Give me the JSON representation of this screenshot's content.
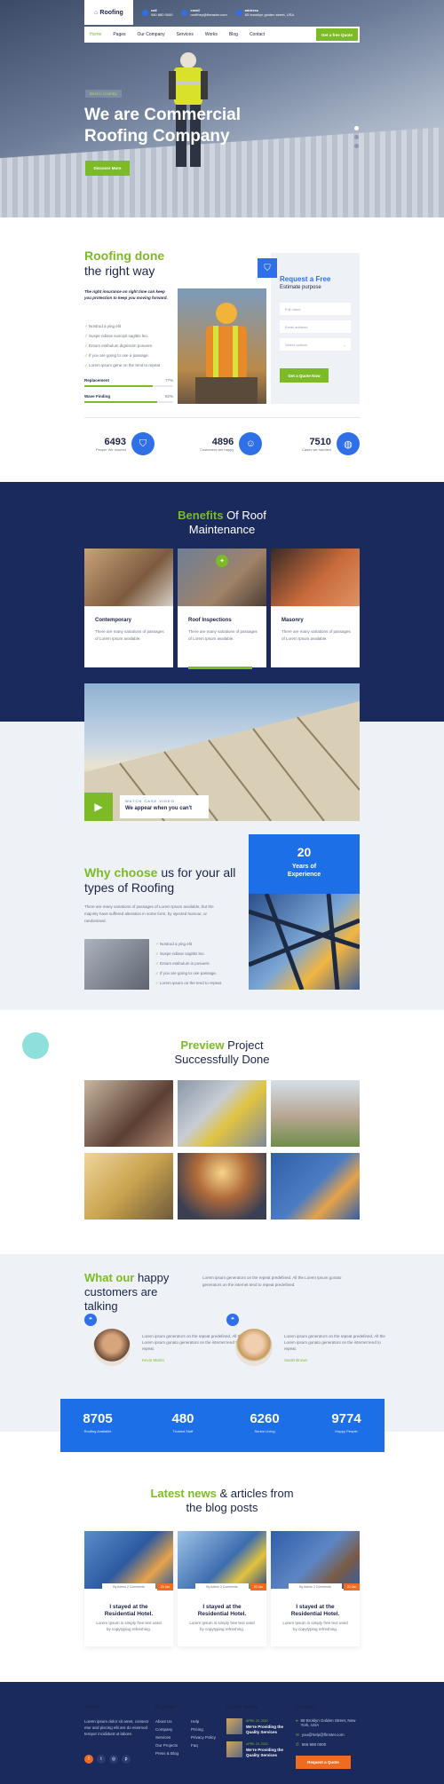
{
  "brand": {
    "logo": "Roofing",
    "accent_green": "#7cbb26",
    "accent_blue": "#2f6fe8",
    "navy": "#1b2a5c"
  },
  "topbar": {
    "call_label": "call",
    "call_value": "080 880 0000",
    "email_label": "email",
    "email_value": "roofthey@flmaster.com",
    "address_label": "address",
    "address_value": "83 brooklyn golden street, USA"
  },
  "nav": {
    "items": [
      "Home",
      "Pages",
      "Our Company",
      "Services",
      "Works",
      "Blog",
      "Contact"
    ],
    "quote_btn": "Get a free Quote"
  },
  "hero": {
    "tag": "Best in Country",
    "title_line1": "We are Commercial",
    "title_line2": "Roofing Company",
    "button": "Discover More"
  },
  "about": {
    "title_green": "Roofing done",
    "title_rest": "the right way",
    "intro": "The right insurance on right time can keep you protection to keep you moving forward.",
    "checks": [
      "Nostrud a ying elit",
      "Suspe ndisse suscipit sagittis leo.",
      "Entum estibulum dignissim posuere.",
      "If you are going to use a passage.",
      "Lorem ipsum gene on the tend to repeat"
    ],
    "skills": [
      {
        "name": "Replacement",
        "pct": "77%",
        "value": 0.77
      },
      {
        "name": "Wave Finding",
        "pct": "82%",
        "value": 0.82
      }
    ]
  },
  "form": {
    "title": "Request a Free",
    "subtitle": "Estimate purpose",
    "name_ph": "Full name",
    "email_ph": "Email address",
    "service_ph": "Select options",
    "button": "Get a Quote Now"
  },
  "stats": [
    {
      "num": "6493",
      "label": "People We Insured",
      "icon": "shield-icon"
    },
    {
      "num": "4896",
      "label": "Customers are happy",
      "icon": "people-icon"
    },
    {
      "num": "7510",
      "label": "Cases we handled",
      "icon": "globe-icon"
    }
  ],
  "benefits": {
    "title_green": "Benefits",
    "title_rest": "Of Roof",
    "title_line2": "Maintenance",
    "cards": [
      {
        "title": "Contemporary",
        "text": "There are many variations of passages of Lorem Ipsum available."
      },
      {
        "title": "Roof Inspections",
        "text": "There are many variations of passages of Lorem Ipsum available."
      },
      {
        "title": "Masonry",
        "text": "There are many variations of passages of Lorem Ipsum available."
      }
    ]
  },
  "video": {
    "small": "WATCH CASE VIDEO",
    "title": "We appear when you can't"
  },
  "why": {
    "title_green": "Why choose",
    "title_rest": "us for your all types of Roofing",
    "text": "There are many variations of passages of Lorem Ipsum available, but the majority have suffered alteration in some form, by injected humour, or randomised.",
    "list": [
      "Nostrud a ying elit",
      "Suspe ndisse sagittis leo.",
      "Entum estibulum is posuere.",
      "If you are going to use passage.",
      "Lorem ipsum on the tend to repeat."
    ],
    "exp_num": "20",
    "exp_text1": "Years of",
    "exp_text2": "Experience"
  },
  "preview": {
    "title_green": "Preview",
    "title_rest": "Project",
    "title_line2": "Successfully Done"
  },
  "testimonials": {
    "title_green": "What our",
    "title_rest": "happy customers are talking",
    "intro": "Lorem ipsum generators on the repeat predefined. All the Lorem Ipsum gonato generators on the internet tend to repeat predefined.",
    "items": [
      {
        "quote": "Lorem ipsum generators on the repeat predefined. All the Lorem ipsum gonato generators on the internet tend to repeat.",
        "name": "Kevin Martin"
      },
      {
        "quote": "Lorem ipsum generators on the repeat predefined. All the Lorem ipsum gonato generators on the internet tend to repeat.",
        "name": "Sarah Brown"
      }
    ]
  },
  "counters": [
    {
      "num": "8705",
      "label": "Roofing Available"
    },
    {
      "num": "480",
      "label": "Trusted Staff"
    },
    {
      "num": "6260",
      "label": "Senior Living"
    },
    {
      "num": "9774",
      "label": "Happy People"
    }
  ],
  "news": {
    "title_green": "Latest news",
    "title_rest": "& articles from",
    "title_line2": "the blog posts",
    "posts": [
      {
        "meta": "By Admin   2 Comments",
        "date": "20 Jan",
        "title1": "I stayed at the",
        "title2": "Residential Hotel.",
        "text": "Lorem Ipsum is simply free text used by copytyping refreshing."
      },
      {
        "meta": "By Admin   2 Comments",
        "date": "20 Jan",
        "title1": "I stayed at the",
        "title2": "Residential Hotel.",
        "text": "Lorem Ipsum is simply free text used by copytyping refreshing."
      },
      {
        "meta": "By Admin   2 Comments",
        "date": "20 Jan",
        "title1": "I stayed at the",
        "title2": "Residential Hotel.",
        "text": "Lorem Ipsum is simply free text used by copytyping refreshing."
      }
    ]
  },
  "footer": {
    "about_h": "About",
    "about_text": "Lorem ipsum dolor sit amet, consect etur and piscing elit are do eiusmod tempor incididunt ut labore.",
    "explore_h": "Explore",
    "explore": [
      "About Us",
      "Company",
      "Services",
      "Our Projects",
      "Press & Blog"
    ],
    "links": [
      "Help",
      "Pricing",
      "Privacy Policy",
      "Faq"
    ],
    "news_h": "Latest News",
    "news": [
      {
        "date": "APRIL 20, 2020",
        "title": "We're Providing the Quality Services"
      },
      {
        "date": "APRIL 20, 2020",
        "title": "We're Providing the Quality Services"
      }
    ],
    "contact_h": "Contact",
    "contact": [
      "88 Broklyn Golden Street, New York, USA",
      "you@help@flmster.com",
      "666 888 0000"
    ],
    "button": "Request a Quote"
  }
}
